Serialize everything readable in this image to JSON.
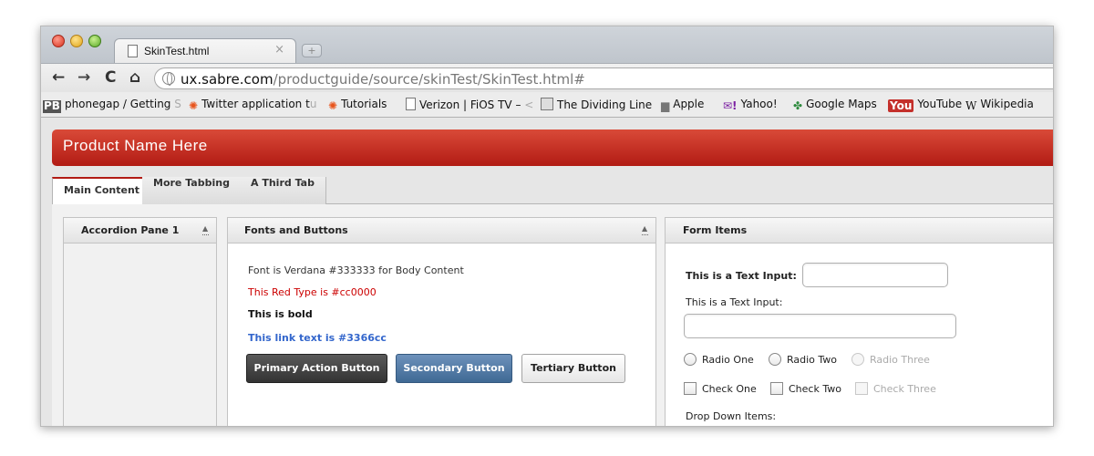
{
  "browser": {
    "tab_title": "SkinTest.html",
    "tab_close": "×",
    "new_tab": "+",
    "url_host": "ux.sabre.com",
    "url_path": "/productguide/source/skinTest/SkinTest.html#",
    "nav": {
      "back": "←",
      "forward": "→",
      "reload": "C",
      "home": "⌂"
    }
  },
  "bookmarks": [
    {
      "label": "phonegap / Getting",
      "fade": " S",
      "icon": "phonegap-icon",
      "glyph": "PB"
    },
    {
      "label": "Twitter application t",
      "fade": "u",
      "icon": "tutorials-star-icon",
      "glyph": "✺"
    },
    {
      "label": "Tutorials",
      "fade": "",
      "icon": "tutorials-star-icon",
      "glyph": "✺"
    },
    {
      "label": "Verizon | FiOS TV –",
      "fade": " <",
      "icon": "document-icon",
      "glyph": ""
    },
    {
      "label": "The Dividing Line",
      "fade": "",
      "icon": "book-icon",
      "glyph": ""
    },
    {
      "label": "Apple",
      "fade": "",
      "icon": "apple-icon",
      "glyph": "▆"
    },
    {
      "label": "Yahoo!",
      "fade": "",
      "icon": "yahoo-icon",
      "glyph": "✉!"
    },
    {
      "label": "Google Maps",
      "fade": "",
      "icon": "google-maps-icon",
      "glyph": "✤"
    },
    {
      "label": "YouTube",
      "fade": "",
      "icon": "youtube-icon",
      "glyph": "You"
    },
    {
      "label": "Wikipedia",
      "fade": "",
      "icon": "wikipedia-icon",
      "glyph": "W"
    }
  ],
  "app": {
    "product_name": "Product Name Here",
    "accent": "#b21b14",
    "tabs": [
      "Main Content",
      "More Tabbing",
      "A Third Tab"
    ],
    "active_tab": "Main Content"
  },
  "accordion": {
    "title": "Accordion Pane 1",
    "arrow": "▲"
  },
  "fonts_panel": {
    "title": "Fonts and Buttons",
    "arrow": "▲",
    "body_text": "Font is Verdana #333333 for Body Content",
    "red_text": "This Red Type is #cc0000",
    "bold_text": "This is bold",
    "link_text": "This link text is #3366cc",
    "buttons": {
      "primary": "Primary Action Button",
      "secondary": "Secondary Button",
      "tertiary": "Tertiary Button"
    }
  },
  "form_panel": {
    "title": "Form Items",
    "inline_label": "This is a Text Input:",
    "inline_value": "",
    "stacked_label": "This is a Text Input:",
    "stacked_value": "",
    "radios": [
      "Radio One",
      "Radio Two",
      "Radio Three"
    ],
    "checks": [
      "Check One",
      "Check Two",
      "Check Three"
    ],
    "dropdown_label": "Drop Down Items:"
  }
}
